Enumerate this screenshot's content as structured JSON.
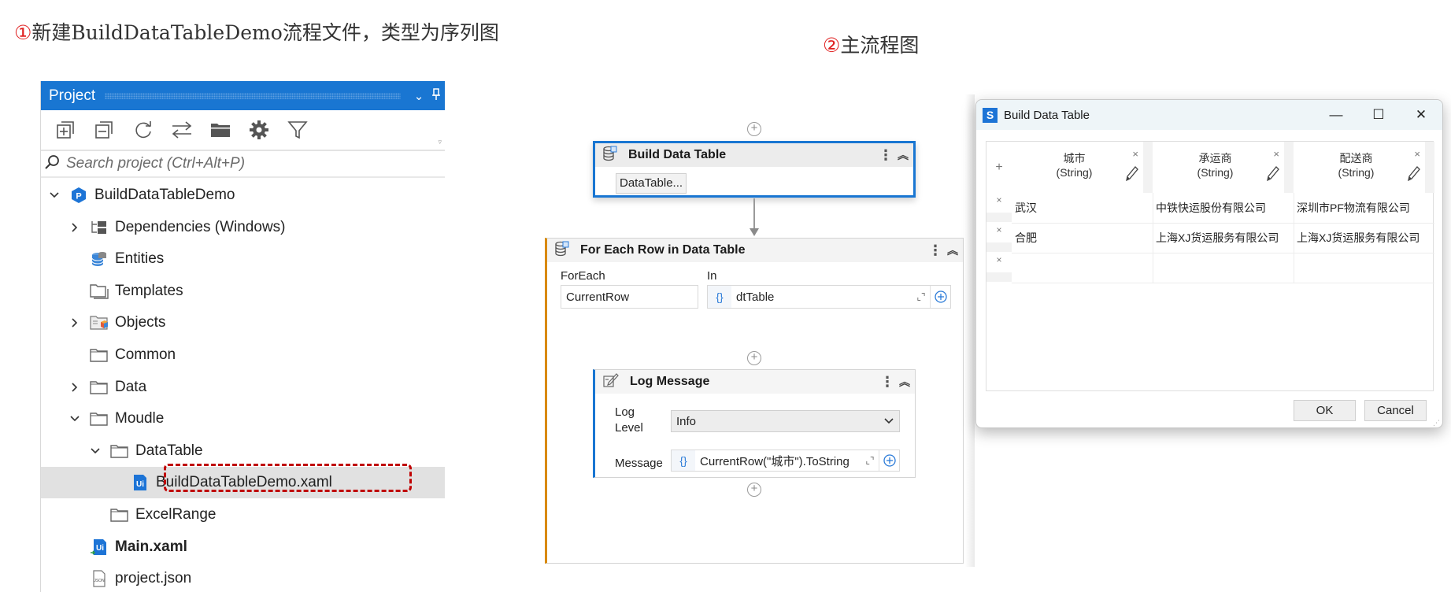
{
  "captions": {
    "step1": {
      "num": "①",
      "text": "新建BuildDataTableDemo流程文件，类型为序列图"
    },
    "step2": {
      "num": "②",
      "text": "主流程图"
    }
  },
  "project_panel": {
    "title": "Project",
    "toolbar_icons": [
      "expand-all-icon",
      "collapse-all-icon",
      "refresh-icon",
      "sync-icon",
      "open-folder-icon",
      "settings-icon",
      "filter-icon"
    ],
    "search_placeholder": "Search project (Ctrl+Alt+P)",
    "tree": [
      {
        "label": "BuildDataTableDemo",
        "icon": "project-icon",
        "level": 0,
        "expander": "expanded"
      },
      {
        "label": "Dependencies (Windows)",
        "icon": "dependencies-icon",
        "level": 1,
        "expander": "collapsed"
      },
      {
        "label": "Entities",
        "icon": "entities-icon",
        "level": 1,
        "expander": "none"
      },
      {
        "label": "Templates",
        "icon": "templates-icon",
        "level": 1,
        "expander": "none"
      },
      {
        "label": "Objects",
        "icon": "objects-icon",
        "level": 1,
        "expander": "collapsed"
      },
      {
        "label": "Common",
        "icon": "folder-icon",
        "level": 1,
        "expander": "none"
      },
      {
        "label": "Data",
        "icon": "folder-icon",
        "level": 1,
        "expander": "collapsed"
      },
      {
        "label": "Moudle",
        "icon": "folder-icon",
        "level": 1,
        "expander": "expanded"
      },
      {
        "label": "DataTable",
        "icon": "folder-icon",
        "level": 2,
        "expander": "expanded"
      },
      {
        "label": "BuildDataTableDemo.xaml",
        "icon": "xaml-file-icon",
        "level": 3,
        "expander": "none",
        "selected": true,
        "highlighted": true
      },
      {
        "label": "ExcelRange",
        "icon": "folder-icon",
        "level": 2,
        "expander": "none"
      },
      {
        "label": "Main.xaml",
        "icon": "main-xaml-icon",
        "level": 1,
        "expander": "none",
        "bold": true
      },
      {
        "label": "project.json",
        "icon": "json-file-icon",
        "level": 1,
        "expander": "none"
      }
    ]
  },
  "workflow": {
    "build_data_table": {
      "title": "Build Data Table",
      "button": "DataTable..."
    },
    "for_each_row": {
      "title": "For Each Row in Data Table",
      "foreach_label": "ForEach",
      "foreach_value": "CurrentRow",
      "in_label": "In",
      "in_value": "dtTable"
    },
    "log_message": {
      "title": "Log Message",
      "level_label_line1": "Log",
      "level_label_line2": "Level",
      "level_value": "Info",
      "message_label": "Message",
      "message_value": "CurrentRow(\"城市\").ToString"
    }
  },
  "dialog": {
    "title": "Build Data Table",
    "window_buttons": {
      "minimize": "—",
      "maximize": "☐",
      "close": "✕"
    },
    "columns": [
      {
        "name": "城市",
        "type": "(String)"
      },
      {
        "name": "承运商",
        "type": "(String)"
      },
      {
        "name": "配送商",
        "type": "(String)"
      }
    ],
    "rows": [
      [
        "武汉",
        "中铁快运股份有限公司",
        "深圳市PF物流有限公司"
      ],
      [
        "合肥",
        "上海XJ货运服务有限公司",
        "上海XJ货运服务有限公司"
      ],
      [
        "",
        "",
        ""
      ]
    ],
    "add_column_label": "+",
    "remove_label": "×",
    "ok_label": "OK",
    "cancel_label": "Cancel"
  },
  "colors": {
    "panel_header": "#1976d2",
    "selection_box": "#c00000",
    "caption_number": "#e02020",
    "for_each_accent": "#d98a00",
    "selected_activity": "#1976d2"
  }
}
